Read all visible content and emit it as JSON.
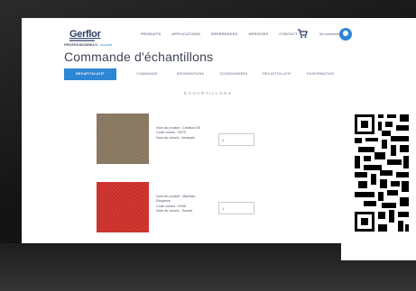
{
  "header": {
    "logo": "Gerflor",
    "nav": [
      "PRODUITS",
      "APPLICATIONS",
      "RÉFÉRENCES",
      "SERVICES",
      "CONTACT"
    ],
    "login": "Se connecter"
  },
  "breadcrumb": {
    "root": "PROFESSIONNELS",
    "current": "Accueil"
  },
  "page_title": "Commande d'échantillons",
  "steps": [
    "RÉCAPITULATIF",
    "COMMANDE",
    "INFORMATIONS",
    "COORDONNÉES",
    "RÉCAPITULATIF",
    "CONFIRMATION"
  ],
  "section_title": "ÉCHANTILLONS",
  "samples": [
    {
      "name": "Nom du produit : Création 55",
      "code": "Code coloris : 0575",
      "color": "Nom du coloris : Amarylis",
      "qty": "1"
    },
    {
      "name": "Nom du produit : Mipolam",
      "name2": "Elegance",
      "code": "Code coloris : 0336",
      "color": "Nom du coloris : Sunset",
      "qty": "1"
    }
  ],
  "colors": {
    "accent": "#2d86d6",
    "title": "#3d4353",
    "swatch_1": "#8b7a62",
    "swatch_2": "#d2312a"
  }
}
